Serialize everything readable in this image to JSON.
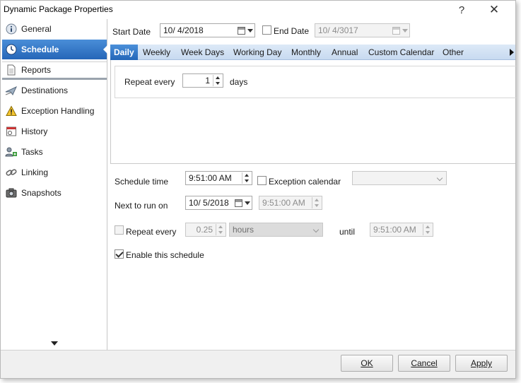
{
  "window": {
    "title": "Dynamic Package Properties",
    "help_glyph": "?",
    "close_glyph": "✕"
  },
  "sidebar": {
    "items": [
      {
        "label": "General",
        "icon": "info-icon"
      },
      {
        "label": "Schedule",
        "icon": "clock-icon",
        "active": true
      },
      {
        "label": "Reports",
        "icon": "document-icon"
      },
      {
        "label": "Destinations",
        "icon": "send-icon"
      },
      {
        "label": "Exception Handling",
        "icon": "warning-icon"
      },
      {
        "label": "History",
        "icon": "history-icon"
      },
      {
        "label": "Tasks",
        "icon": "tasks-icon"
      },
      {
        "label": "Linking",
        "icon": "link-icon"
      },
      {
        "label": "Snapshots",
        "icon": "camera-icon"
      }
    ]
  },
  "schedule": {
    "start_date_label": "Start Date",
    "start_date_value": "10/  4/2018",
    "end_date_label": "End Date",
    "end_date_value": "10/  4/3017",
    "tabs": [
      "Daily",
      "Weekly",
      "Week Days",
      "Working Day",
      "Monthly",
      "Annual",
      "Custom Calendar",
      "Other"
    ],
    "active_tab": "Daily",
    "repeat_every_label": "Repeat every",
    "repeat_every_value": "1",
    "days_label": "days",
    "schedule_time_label": "Schedule time",
    "schedule_time_value": "9:51:00 AM",
    "exception_calendar_label": "Exception calendar",
    "exception_calendar_value": "",
    "next_to_run_label": "Next to run on",
    "next_run_date": "10/  5/2018",
    "next_run_time": "9:51:00 AM",
    "repeat_label": "Repeat every",
    "repeat_value": "0.25",
    "repeat_unit": "hours",
    "until_label": "until",
    "until_value": "9:51:00 AM",
    "enable_label": "Enable this schedule",
    "enable_checked": true
  },
  "buttons": {
    "ok": "OK",
    "cancel": "Cancel",
    "apply": "Apply"
  },
  "colors": {
    "accent": "#2566b8",
    "tab_strip": "#c8daf0"
  }
}
